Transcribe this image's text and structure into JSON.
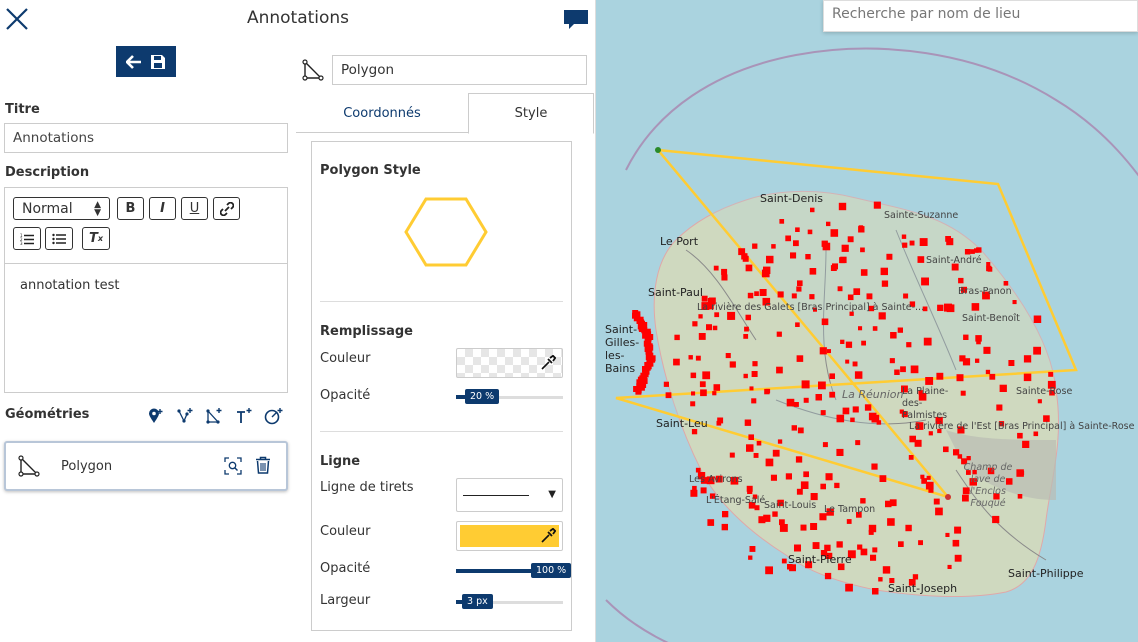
{
  "panel": {
    "title": "Annotations",
    "close_icon": "close-icon",
    "chat_icon": "comment-icon",
    "back_icon": "arrow-left-icon",
    "save_icon": "floppy-disk-icon"
  },
  "form": {
    "title_label": "Titre",
    "title_value": "Annotations",
    "description_label": "Description",
    "format_select": "Normal",
    "description_text": "annotation test"
  },
  "geometries": {
    "label": "Géométries",
    "tools": [
      "add-marker-icon",
      "add-line-icon",
      "add-polygon-icon",
      "add-text-icon",
      "add-circle-icon"
    ],
    "items": [
      {
        "label": "Polygon",
        "icon": "polygon-icon",
        "actions": [
          "zoom-to-icon",
          "trash-icon"
        ]
      }
    ]
  },
  "geometry_editor": {
    "name_value": "Polygon",
    "tabs": [
      {
        "label": "Coordonnés",
        "active": false
      },
      {
        "label": "Style",
        "active": true
      }
    ],
    "style": {
      "section_title": "Polygon Style",
      "fill": {
        "title": "Remplissage",
        "color_label": "Couleur",
        "color_value": "transparent",
        "opacity_label": "Opacité",
        "opacity_value": "20 %",
        "opacity_fraction": 0.2
      },
      "line": {
        "title": "Ligne",
        "dash_label": "Ligne de tirets",
        "color_label": "Couleur",
        "color_value": "#ffcc33",
        "opacity_label": "Opacité",
        "opacity_value": "100 %",
        "opacity_fraction": 1.0,
        "width_label": "Largeur",
        "width_value": "3 px",
        "width_fraction": 0.1
      }
    }
  },
  "map": {
    "search_placeholder": "Recherche par nom de lieu",
    "colors": {
      "sea": "#aad3df",
      "land": "#cfd9bf",
      "polygon_stroke": "#ffcc33",
      "points": "#ff0000",
      "accent": "#0d3a6e"
    },
    "labels": [
      "Saint-Denis",
      "Sainte-Suzanne",
      "Le Port",
      "Saint-Paul",
      "Saint-Gilles-les-Bains",
      "Saint-André",
      "Bras-Panon",
      "Saint-Benoît",
      "Sainte-Rose",
      "La Plaine-des-Palmistes",
      "Saint-Leu",
      "Les Avirons",
      "L'Étang-Salé",
      "Saint-Louis",
      "Saint-Pierre",
      "Saint-Joseph",
      "Saint-Philippe",
      "Le Tampon",
      "La Réunion",
      "La rivière des Galets [Bras Principal] à Sainte-...",
      "La rivière de l'Est [Bras Principal] à Sainte-Rose",
      "Champ de lave de l'Enclos Fouqué"
    ]
  }
}
